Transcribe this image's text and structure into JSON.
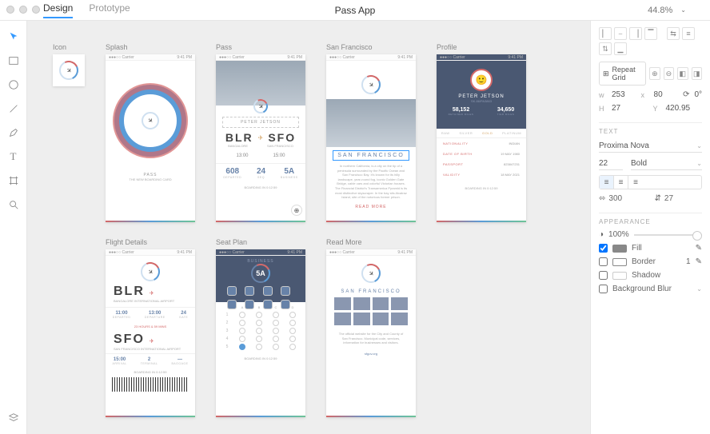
{
  "mac": {
    "close": "",
    "min": "",
    "max": ""
  },
  "topbar": {
    "tabs": [
      "Design",
      "Prototype"
    ],
    "title": "Pass App",
    "zoom": "44.8%"
  },
  "artboards": {
    "row1_labels": [
      "Icon",
      "Splash",
      "Pass",
      "San Francisco",
      "Profile"
    ],
    "row2_labels": [
      "Flight Details",
      "Seat Plan",
      "Read More"
    ],
    "status_carrier": "●●●○○ Carrier",
    "status_time": "9:41 PM",
    "splash": {
      "title": "PASS",
      "sub": "THE NEW BOARDING CARD"
    },
    "pass": {
      "name": "PETER JETSON",
      "from": "BLR",
      "to": "SFO",
      "from_sub": "BANGALORE",
      "to_sub": "SAN FRANCISCO",
      "time1": "13:00",
      "time2": "15:00",
      "n1": "608",
      "l1": "DEPARTED",
      "n2": "24",
      "l2": "SEQ",
      "n3": "5A",
      "l3": "BUSINESS",
      "foot": "BOARDING IN 0:12:59"
    },
    "sf": {
      "title": "SAN FRANCISCO",
      "body": "In northern California, is a city on the tip of a peninsula surrounded by the Pacific Ocean and San Francisco Bay. It's known for its hilly landscape, year-round fog, iconic Golden Gate Bridge, cable cars and colorful Victorian houses. The Financial District's Transamerica Pyramid is its most distinctive skyscraper. In the bay sits Alcatraz Island, site of the notorious former prison.",
      "more": "READ MORE"
    },
    "profile": {
      "name": "PETER JETSON",
      "id": "SK.86/PA3863",
      "stat1": "58,152",
      "stat1l": "RETAINED MILES",
      "stat2": "34,650",
      "stat2l": "TIER MILES",
      "tabs": [
        "RAW",
        "SILVER",
        "GOLD",
        "PLATINUM"
      ],
      "kv": [
        [
          "NATIONALITY",
          "INDIAN"
        ],
        [
          "DATE OF BIRTH",
          "19 MAY 1980"
        ],
        [
          "PASSPORT",
          "823847231"
        ],
        [
          "VALIDITY",
          "18 MAY 2021"
        ]
      ],
      "foot": "BOARDING IN 0:12:59"
    },
    "fd": {
      "from": "BLR",
      "from_sub": "BANGALORE INTERNATIONAL AIRPORT",
      "to": "SFO",
      "to_sub": "SAN FRANCISCO INTERNATIONAL AIRPORT",
      "r1": [
        [
          "11:00",
          "DEPARTED"
        ],
        [
          "13:00",
          "DEPARTURE"
        ],
        [
          "24",
          "GATE"
        ]
      ],
      "mid": "23 HOURS & 59 MINS",
      "r2": [
        [
          "15:00",
          "ARRIVAL"
        ],
        [
          "2",
          "TERMINAL"
        ],
        [
          "—",
          "BAGGAGE"
        ]
      ],
      "foot": "BOARDING IN 0:12:59"
    },
    "seat": {
      "class": "BUSINESS",
      "num": "5A",
      "cols": [
        "A",
        "B",
        "C",
        "D"
      ],
      "rows": [
        "1",
        "2",
        "3",
        "4",
        "5"
      ],
      "foot": "BOARDING IN 0:12:59"
    },
    "rm": {
      "title": "SAN FRANCISCO",
      "body": "The official website for the City and County of San Francisco. Municipal code, services, information for businesses and visitors.",
      "link": "sfgov.org"
    }
  },
  "props": {
    "repeat": "Repeat Grid",
    "w": "253",
    "x": "80",
    "rot": "0°",
    "h": "27",
    "y": "420.95",
    "text_section": "TEXT",
    "font": "Proxima Nova",
    "size": "22",
    "weight": "Bold",
    "tracking": "300",
    "leading": "27",
    "appearance": "APPEARANCE",
    "opacity": "100%",
    "fill": "Fill",
    "border": "Border",
    "border_w": "1",
    "shadow": "Shadow",
    "blur": "Background Blur"
  }
}
